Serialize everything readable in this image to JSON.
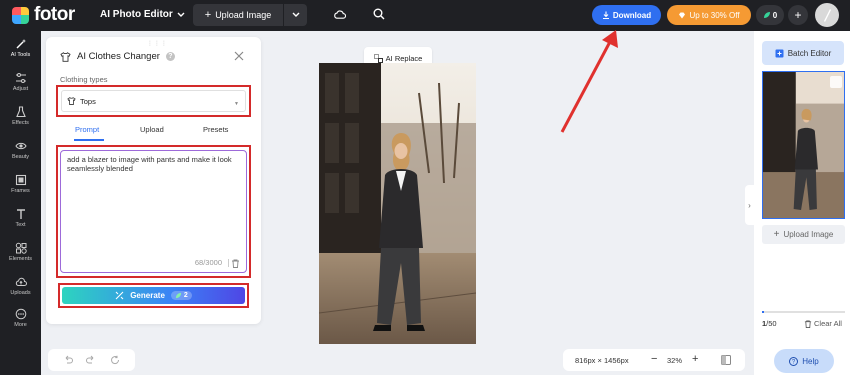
{
  "topbar": {
    "logo_text": "fotor",
    "editor_menu": "AI Photo Editor",
    "upload_label": "Upload Image",
    "download_label": "Download",
    "promo_label": "Up to 30% Off",
    "credits_count": "0",
    "plus_label": "+"
  },
  "rail": {
    "items": [
      {
        "label": "AI Tools",
        "icon": "magic-wand-icon"
      },
      {
        "label": "Adjust",
        "icon": "sliders-icon"
      },
      {
        "label": "Effects",
        "icon": "flask-icon"
      },
      {
        "label": "Beauty",
        "icon": "eye-icon"
      },
      {
        "label": "Frames",
        "icon": "frame-icon"
      },
      {
        "label": "Text",
        "icon": "text-icon"
      },
      {
        "label": "Elements",
        "icon": "shapes-icon"
      },
      {
        "label": "Uploads",
        "icon": "cloud-upload-icon"
      },
      {
        "label": "More",
        "icon": "more-icon"
      }
    ]
  },
  "panel": {
    "title": "AI Clothes Changer",
    "clothing_label": "Clothing types",
    "clothing_value": "Tops",
    "tabs": [
      "Prompt",
      "Upload",
      "Presets"
    ],
    "active_tab": "Prompt",
    "prompt_text": "add a blazer to image with pants and make it look seamlessly blended",
    "counter": "68/3000",
    "generate_label": "Generate",
    "generate_cost": "2"
  },
  "canvas": {
    "ai_replace_label": "AI Replace",
    "dimensions": "816px × 1456px",
    "zoom": "32%"
  },
  "right_panel": {
    "batch_label": "Batch Editor",
    "upload_label": "Upload Image",
    "count_current": "1",
    "count_total": "/50",
    "progress": 0.02,
    "clear_label": "Clear All",
    "help_label": "Help"
  },
  "colors": {
    "accent": "#2f6ff0",
    "highlight": "#d42a2a",
    "promo": "#f59a33",
    "dark": "#1f2024"
  }
}
